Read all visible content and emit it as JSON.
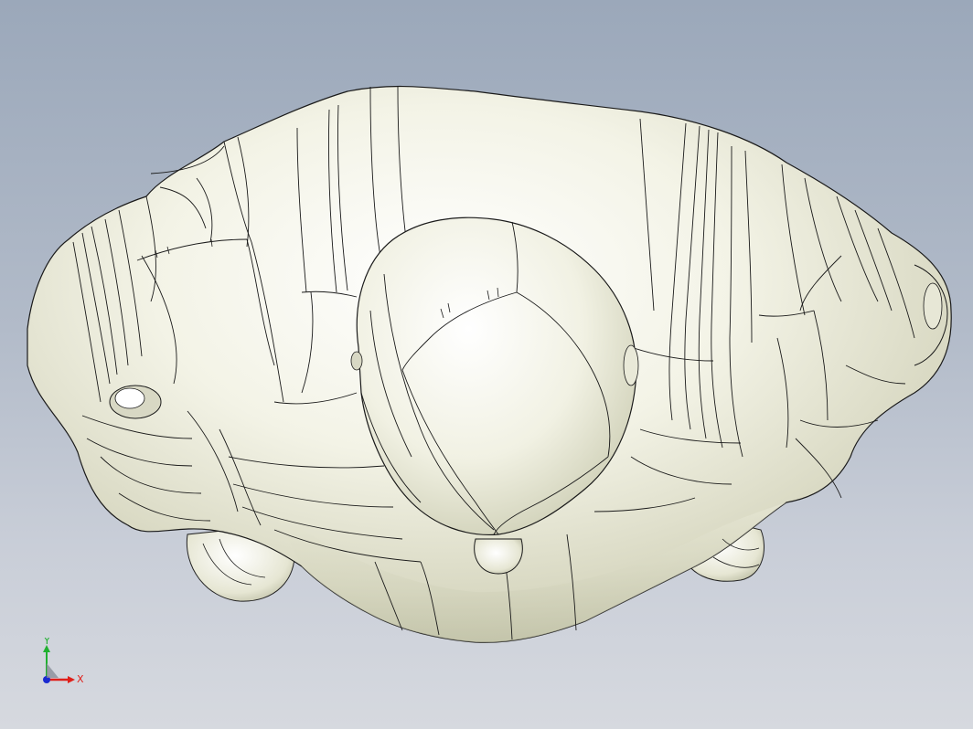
{
  "viewport": {
    "background_top": "#9ba8ba",
    "background_bottom": "#d6d9df",
    "model_fill": "#eeeedf",
    "model_shadow": "#c8c9b0",
    "edge_color": "#1a1a1a"
  },
  "triad": {
    "x_label": "X",
    "y_label": "Y",
    "x_color": "#e0201a",
    "y_color": "#20b030",
    "z_color": "#1a2ad0"
  }
}
